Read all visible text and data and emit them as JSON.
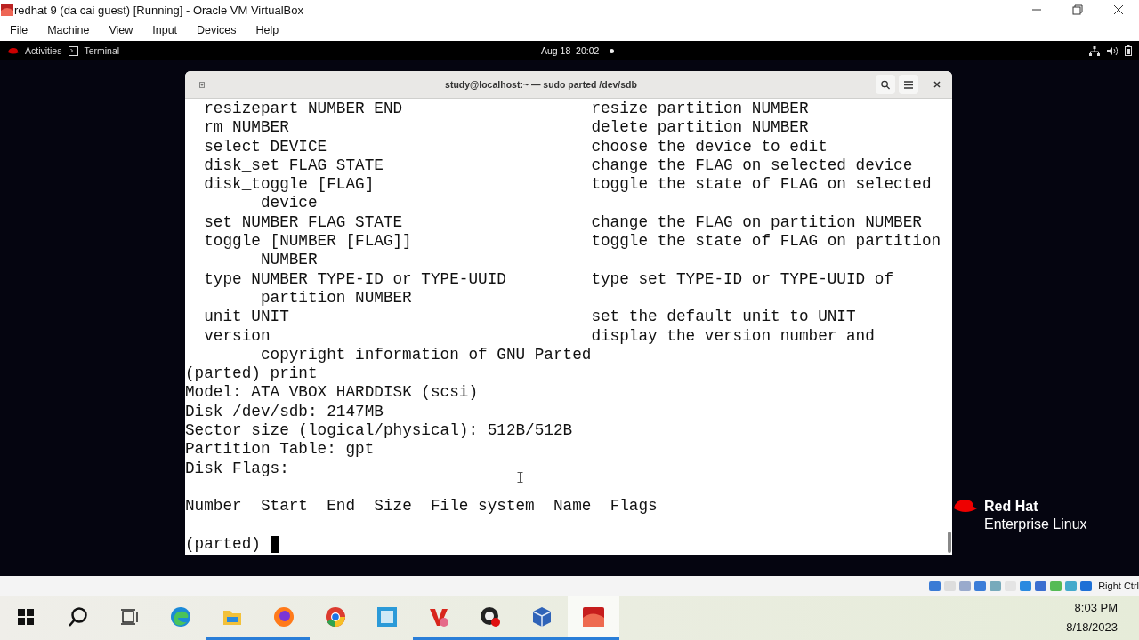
{
  "host_window": {
    "title": "redhat 9 (da cai guest) [Running] - Oracle VM VirtualBox",
    "menu": [
      "File",
      "Machine",
      "View",
      "Input",
      "Devices",
      "Help"
    ]
  },
  "gnome_bar": {
    "activities": "Activities",
    "app": "Terminal",
    "clock": "Aug 18  20:02"
  },
  "terminal": {
    "title": "study@localhost:~ — sudo parted /dev/sdb",
    "lines": [
      {
        "kind": "help",
        "command": "resizepart NUMBER END",
        "description": "resize partition NUMBER"
      },
      {
        "kind": "help",
        "command": "rm NUMBER",
        "description": "delete partition NUMBER"
      },
      {
        "kind": "help",
        "command": "select DEVICE",
        "description": "choose the device to edit"
      },
      {
        "kind": "help",
        "command": "disk_set FLAG STATE",
        "description": "change the FLAG on selected device"
      },
      {
        "kind": "help",
        "command": "disk_toggle [FLAG]",
        "description": "toggle the state of FLAG on selected"
      },
      {
        "kind": "wrap",
        "text": "device"
      },
      {
        "kind": "help",
        "command": "set NUMBER FLAG STATE",
        "description": "change the FLAG on partition NUMBER"
      },
      {
        "kind": "help",
        "command": "toggle [NUMBER [FLAG]]",
        "description": "toggle the state of FLAG on partition"
      },
      {
        "kind": "wrap",
        "text": "NUMBER"
      },
      {
        "kind": "help",
        "command": "type NUMBER TYPE-ID or TYPE-UUID",
        "description": "type set TYPE-ID or TYPE-UUID of"
      },
      {
        "kind": "wrap",
        "text": "partition NUMBER"
      },
      {
        "kind": "help",
        "command": "unit UNIT",
        "description": "set the default unit to UNIT"
      },
      {
        "kind": "help",
        "command": "version",
        "description": "display the version number and"
      },
      {
        "kind": "wrap",
        "text": "copyright information of GNU Parted"
      },
      {
        "kind": "output",
        "text": "(parted) print"
      },
      {
        "kind": "output",
        "text": "Model: ATA VBOX HARDDISK (scsi)"
      },
      {
        "kind": "output",
        "text": "Disk /dev/sdb: 2147MB"
      },
      {
        "kind": "output",
        "text": "Sector size (logical/physical): 512B/512B"
      },
      {
        "kind": "output",
        "text": "Partition Table: gpt"
      },
      {
        "kind": "output",
        "text": "Disk Flags:"
      },
      {
        "kind": "blank"
      },
      {
        "kind": "output",
        "text": "Number  Start  End  Size  File system  Name  Flags"
      },
      {
        "kind": "blank"
      },
      {
        "kind": "prompt",
        "text": "(parted)",
        "cursor": true
      }
    ]
  },
  "logo": {
    "line1": "Red Hat",
    "line2": "Enterprise Linux"
  },
  "status_bar": {
    "host_key": "Right Ctrl"
  },
  "taskbar": {
    "apps": [
      {
        "kind": "start",
        "running": false,
        "selected": false
      },
      {
        "kind": "search",
        "running": false,
        "selected": false
      },
      {
        "kind": "taskview",
        "running": false,
        "selected": false
      },
      {
        "kind": "edge",
        "running": false,
        "selected": false
      },
      {
        "kind": "folder",
        "running": true,
        "selected": false
      },
      {
        "kind": "firefox",
        "running": true,
        "selected": false
      },
      {
        "kind": "chrome",
        "running": false,
        "selected": false
      },
      {
        "kind": "tile",
        "running": false,
        "selected": false
      },
      {
        "kind": "wps",
        "running": true,
        "selected": false
      },
      {
        "kind": "obs",
        "running": true,
        "selected": false
      },
      {
        "kind": "cube",
        "running": true,
        "selected": false
      },
      {
        "kind": "vm",
        "running": true,
        "selected": true
      }
    ],
    "time": "8:03 PM",
    "date": "8/18/2023"
  }
}
